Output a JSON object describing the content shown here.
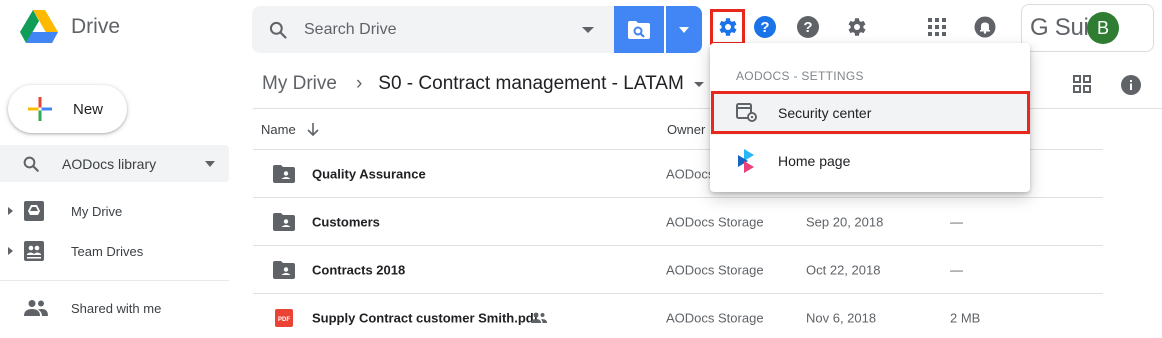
{
  "app": {
    "name": "Drive"
  },
  "search": {
    "placeholder": "Search Drive"
  },
  "new_button": {
    "label": "New"
  },
  "sidebar": {
    "library_selector": "AODocs library",
    "items": [
      {
        "label": "My Drive",
        "icon": "drive-icon"
      },
      {
        "label": "Team Drives",
        "icon": "team-drives-icon"
      },
      {
        "label": "Shared with me",
        "icon": "people-icon"
      }
    ]
  },
  "account": {
    "suite": "G Suite",
    "avatar_initial": "B"
  },
  "breadcrumb": {
    "root": "My Drive",
    "current": "S0 - Contract management - LATAM"
  },
  "table": {
    "columns": [
      "Name",
      "Owner"
    ],
    "rows": [
      {
        "name": "Quality Assurance",
        "owner": "AODocs",
        "modified": "",
        "size": "",
        "type": "folder"
      },
      {
        "name": "Customers",
        "owner": "AODocs Storage",
        "modified": "Sep 20, 2018",
        "size": "—",
        "type": "folder"
      },
      {
        "name": "Contracts 2018",
        "owner": "AODocs Storage",
        "modified": "Oct 22, 2018",
        "size": "—",
        "type": "folder"
      },
      {
        "name": "Supply Contract customer Smith.pdf",
        "owner": "AODocs Storage",
        "modified": "Nov 6, 2018",
        "size": "2 MB",
        "type": "pdf",
        "badge": "PDF"
      }
    ]
  },
  "menu": {
    "title": "AODOCS - SETTINGS",
    "items": [
      {
        "label": "Security center",
        "icon": "security-center-icon"
      },
      {
        "label": "Home page",
        "icon": "aodocs-logo-icon"
      }
    ]
  },
  "colors": {
    "accent": "#4285f4",
    "highlight": "#e8281c",
    "avatar": "#2e7d32"
  }
}
